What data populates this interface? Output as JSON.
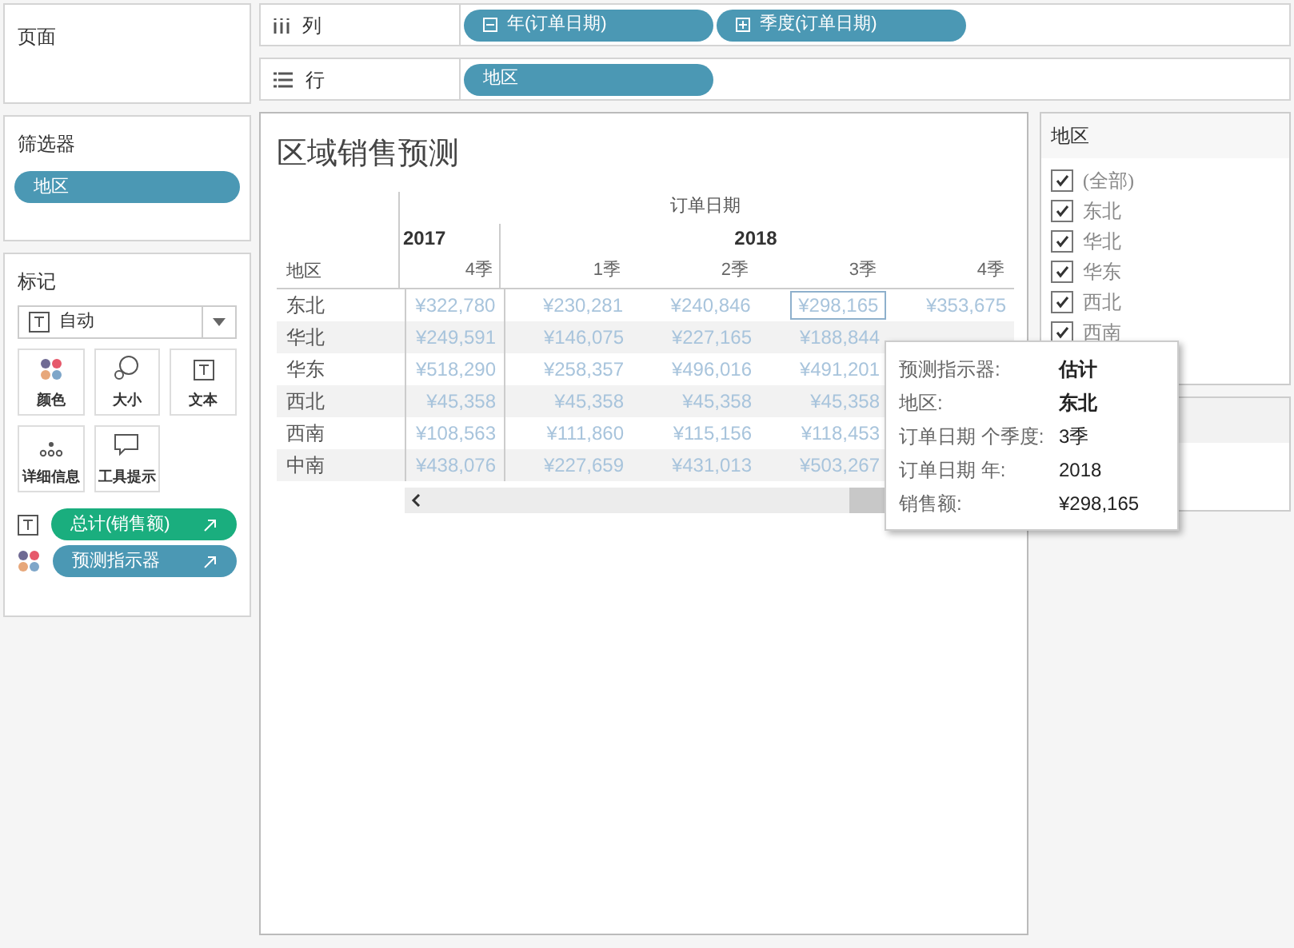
{
  "pages_panel": {
    "title": "页面"
  },
  "columns_shelf": {
    "label": "列",
    "pills": [
      {
        "label": "年(订单日期)",
        "kind": "collapse"
      },
      {
        "label": "季度(订单日期)",
        "kind": "expand"
      }
    ]
  },
  "rows_shelf": {
    "label": "行",
    "pills": [
      {
        "label": "地区"
      }
    ]
  },
  "filters_panel": {
    "title": "筛选器",
    "pills": [
      {
        "label": "地区"
      }
    ]
  },
  "marks_panel": {
    "title": "标记",
    "mark_type": "自动",
    "buttons": [
      {
        "label": "颜色",
        "kind": "color"
      },
      {
        "label": "大小",
        "kind": "size"
      },
      {
        "label": "文本",
        "kind": "text"
      },
      {
        "label": "详细信息",
        "kind": "detail"
      },
      {
        "label": "工具提示",
        "kind": "tooltip"
      }
    ],
    "pills": [
      {
        "label": "总计(销售额)",
        "kind": "text",
        "color": "#1aae7e"
      },
      {
        "label": "预测指示器",
        "kind": "color",
        "color": "#4b98b4"
      }
    ]
  },
  "view": {
    "title": "区域销售预测",
    "header": "订单日期",
    "row_header": "地区",
    "years": [
      {
        "label": "2017",
        "quarters": [
          "4季"
        ]
      },
      {
        "label": "2018",
        "quarters": [
          "1季",
          "2季",
          "3季",
          "4季"
        ]
      }
    ],
    "rows": [
      {
        "region": "东北",
        "cells": [
          {
            "value": "¥322,780",
            "selected": false
          },
          {
            "value": "¥230,281",
            "selected": false
          },
          {
            "value": "¥240,846",
            "selected": false
          },
          {
            "value": "¥298,165",
            "selected": true
          },
          {
            "value": "¥353,675",
            "selected": false
          }
        ]
      },
      {
        "region": "华北",
        "cells": [
          {
            "value": "¥249,591",
            "selected": false
          },
          {
            "value": "¥146,075",
            "selected": false
          },
          {
            "value": "¥227,165",
            "selected": false
          },
          {
            "value": "¥188,844",
            "selected": false
          }
        ]
      },
      {
        "region": "华东",
        "cells": [
          {
            "value": "¥518,290",
            "selected": false
          },
          {
            "value": "¥258,357",
            "selected": false
          },
          {
            "value": "¥496,016",
            "selected": false
          },
          {
            "value": "¥491,201",
            "selected": false
          }
        ]
      },
      {
        "region": "西北",
        "cells": [
          {
            "value": "¥45,358",
            "selected": false
          },
          {
            "value": "¥45,358",
            "selected": false
          },
          {
            "value": "¥45,358",
            "selected": false
          },
          {
            "value": "¥45,358",
            "selected": false
          }
        ]
      },
      {
        "region": "西南",
        "cells": [
          {
            "value": "¥108,563",
            "selected": false
          },
          {
            "value": "¥111,860",
            "selected": false
          },
          {
            "value": "¥115,156",
            "selected": false
          },
          {
            "value": "¥118,453",
            "selected": false
          }
        ]
      },
      {
        "region": "中南",
        "cells": [
          {
            "value": "¥438,076",
            "selected": false
          },
          {
            "value": "¥227,659",
            "selected": false
          },
          {
            "value": "¥431,013",
            "selected": false
          },
          {
            "value": "¥503,267",
            "selected": false
          }
        ]
      }
    ]
  },
  "tooltip": {
    "rows": [
      {
        "label": "预测指示器:",
        "value": "估计",
        "bold": true
      },
      {
        "label": "地区:",
        "value": "东北",
        "bold": true
      },
      {
        "label": "订单日期 个季度:",
        "value": "3季",
        "bold": false
      },
      {
        "label": "订单日期 年:",
        "value": "2018",
        "bold": false
      },
      {
        "label": "销售额:",
        "value": "¥298,165",
        "bold": false
      }
    ]
  },
  "filter_card": {
    "title": "地区",
    "items": [
      {
        "label": "(全部)",
        "checked": true
      },
      {
        "label": "东北",
        "checked": true
      },
      {
        "label": "华北",
        "checked": true
      },
      {
        "label": "华东",
        "checked": true
      },
      {
        "label": "西北",
        "checked": true
      },
      {
        "label": "西南",
        "checked": true
      }
    ]
  }
}
